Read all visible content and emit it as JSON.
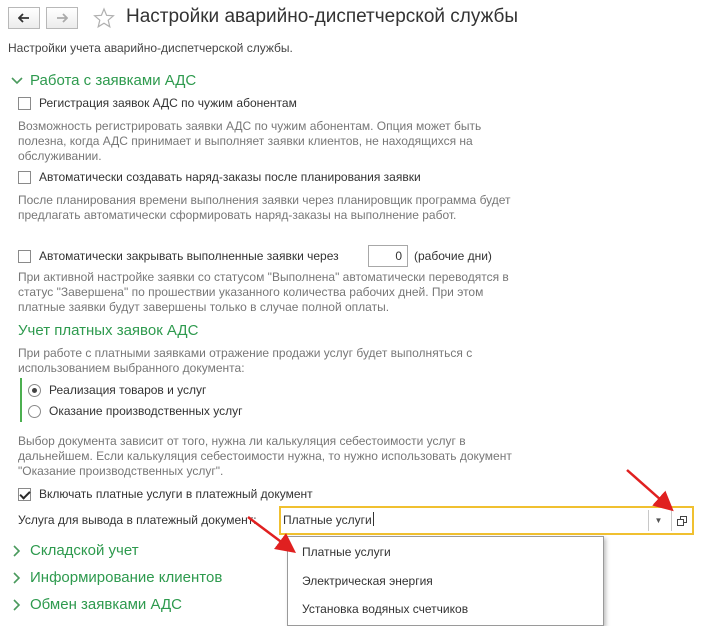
{
  "window": {
    "title": "Настройки аварийно-диспетчерской службы",
    "subtitle": "Настройки учета аварийно-диспетчерской службы."
  },
  "groups": {
    "ads": {
      "label": "Работа с заявками АДС",
      "expanded": true,
      "register_foreign": {
        "label": "Регистрация заявок АДС по чужим абонентам",
        "checked": false,
        "hint": "Возможность регистрировать заявки АДС по чужим абонентам. Опция может быть полезна, когда АДС принимает и выполняет заявки клиентов, не находящихся на обслуживании."
      },
      "auto_orders": {
        "label": "Автоматически создавать наряд-заказы после планирования заявки",
        "checked": false,
        "hint": "После планирования времени выполнения заявки через планировщик программа будет предлагать автоматически сформировать наряд-заказы на выполнение работ."
      },
      "auto_close": {
        "label": "Автоматически закрывать выполненные заявки через",
        "checked": false,
        "value": "0",
        "unit": "(рабочие дни)",
        "hint": "При активной настройке заявки со статусом \"Выполнена\" автоматически переводятся в статус \"Завершена\" по прошествии указанного количества рабочих дней. При этом платные заявки будут завершены только в случае полной оплаты."
      }
    },
    "paid": {
      "label": "Учет платных заявок АДС",
      "hint": "При работе с платными заявками отражение продажи услуг будет выполняться с использованием выбранного документа:",
      "options": [
        {
          "label": "Реализация товаров и услуг",
          "selected": true
        },
        {
          "label": "Оказание производственных услуг",
          "selected": false
        }
      ],
      "choice_hint": "Выбор документа зависит от того, нужна ли калькуляция себестоимости услуг в дальнейшем. Если калькуляция себестоимости нужна, то нужно использовать документ \"Оказание производственных услуг\".",
      "include_paid": {
        "label": "Включать платные услуги в платежный документ",
        "checked": true
      },
      "service": {
        "label": "Услуга для вывода в платежный документ:",
        "value": "Платные услуги",
        "dropdown_items": [
          "Платные услуги",
          "Электрическая энергия",
          "Установка водяных счетчиков"
        ]
      }
    },
    "collapsed": [
      {
        "label": "Складской учет"
      },
      {
        "label": "Информирование клиентов"
      },
      {
        "label": "Обмен заявками АДС"
      }
    ]
  },
  "colors": {
    "accent_green": "#2e9a4e",
    "highlight_border": "#f0c030",
    "annotation_arrow": "#e02020"
  }
}
